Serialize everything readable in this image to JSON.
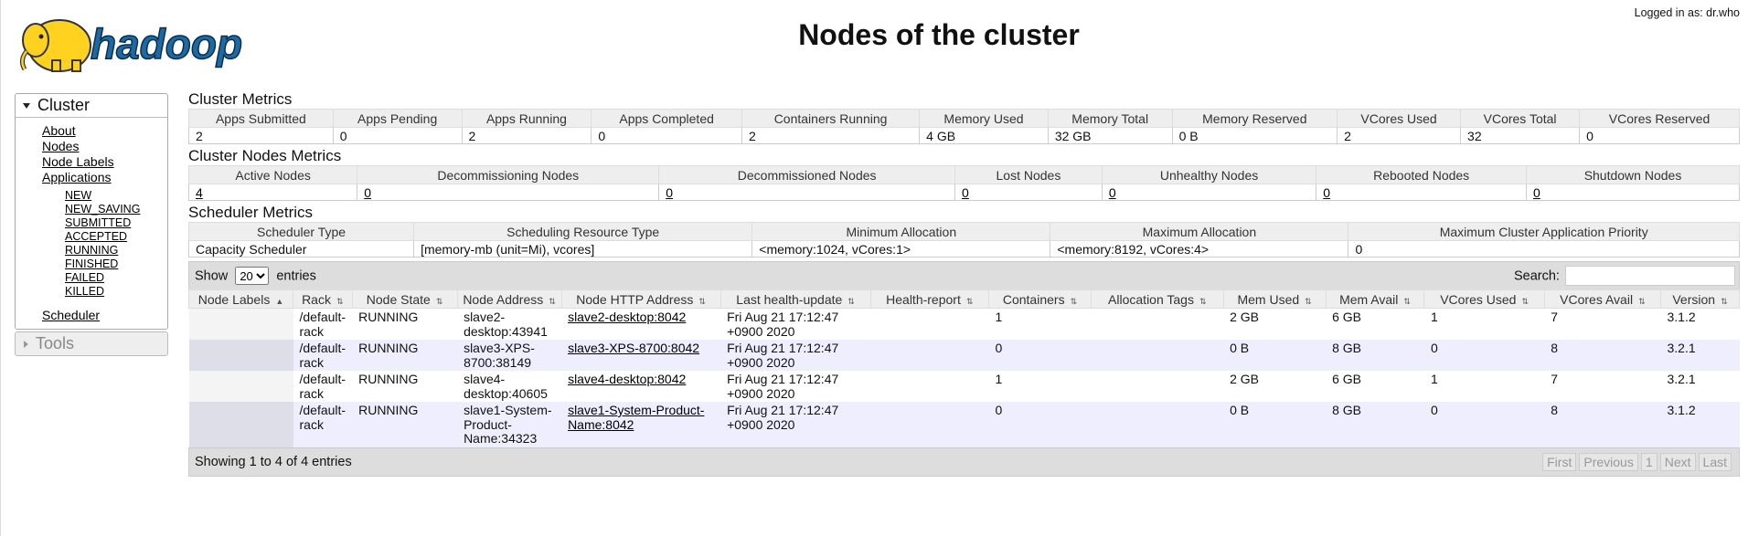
{
  "header": {
    "logo_text": "hadoop",
    "title": "Nodes of the cluster",
    "logged_in": "Logged in as: dr.who"
  },
  "nav": {
    "cluster_label": "Cluster",
    "links": [
      "About",
      "Nodes",
      "Node Labels",
      "Applications"
    ],
    "app_states": [
      "NEW",
      "NEW_SAVING",
      "SUBMITTED",
      "ACCEPTED",
      "RUNNING",
      "FINISHED",
      "FAILED",
      "KILLED"
    ],
    "scheduler": "Scheduler",
    "tools_label": "Tools"
  },
  "cluster_metrics": {
    "title": "Cluster Metrics",
    "headers": [
      "Apps Submitted",
      "Apps Pending",
      "Apps Running",
      "Apps Completed",
      "Containers Running",
      "Memory Used",
      "Memory Total",
      "Memory Reserved",
      "VCores Used",
      "VCores Total",
      "VCores Reserved"
    ],
    "values": [
      "2",
      "0",
      "2",
      "0",
      "2",
      "4 GB",
      "32 GB",
      "0 B",
      "2",
      "32",
      "0"
    ]
  },
  "node_metrics": {
    "title": "Cluster Nodes Metrics",
    "headers": [
      "Active Nodes",
      "Decommissioning Nodes",
      "Decommissioned Nodes",
      "Lost Nodes",
      "Unhealthy Nodes",
      "Rebooted Nodes",
      "Shutdown Nodes"
    ],
    "values": [
      "4",
      "0",
      "0",
      "0",
      "0",
      "0",
      "0"
    ]
  },
  "scheduler_metrics": {
    "title": "Scheduler Metrics",
    "headers": [
      "Scheduler Type",
      "Scheduling Resource Type",
      "Minimum Allocation",
      "Maximum Allocation",
      "Maximum Cluster Application Priority"
    ],
    "values": [
      "Capacity Scheduler",
      "[memory-mb (unit=Mi), vcores]",
      "<memory:1024, vCores:1>",
      "<memory:8192, vCores:4>",
      "0"
    ]
  },
  "table_controls": {
    "show": "Show",
    "entries_value": "20",
    "entries": "entries",
    "search": "Search:"
  },
  "nodes": {
    "headers": [
      "Node Labels",
      "Rack",
      "Node State",
      "Node Address",
      "Node HTTP Address",
      "Last health-update",
      "Health-report",
      "Containers",
      "Allocation Tags",
      "Mem Used",
      "Mem Avail",
      "VCores Used",
      "VCores Avail",
      "Version"
    ],
    "rows": [
      {
        "labels": "",
        "rack": "/default-rack",
        "state": "RUNNING",
        "address": "slave2-desktop:43941",
        "http": "slave2-desktop:8042",
        "health": "Fri Aug 21 17:12:47 +0900 2020",
        "report": "",
        "containers": "1",
        "tags": "",
        "mem_used": "2 GB",
        "mem_avail": "6 GB",
        "vc_used": "1",
        "vc_avail": "7",
        "version": "3.1.2"
      },
      {
        "labels": "",
        "rack": "/default-rack",
        "state": "RUNNING",
        "address": "slave3-XPS-8700:38149",
        "http": "slave3-XPS-8700:8042",
        "health": "Fri Aug 21 17:12:47 +0900 2020",
        "report": "",
        "containers": "0",
        "tags": "",
        "mem_used": "0 B",
        "mem_avail": "8 GB",
        "vc_used": "0",
        "vc_avail": "8",
        "version": "3.2.1"
      },
      {
        "labels": "",
        "rack": "/default-rack",
        "state": "RUNNING",
        "address": "slave4-desktop:40605",
        "http": "slave4-desktop:8042",
        "health": "Fri Aug 21 17:12:47 +0900 2020",
        "report": "",
        "containers": "1",
        "tags": "",
        "mem_used": "2 GB",
        "mem_avail": "6 GB",
        "vc_used": "1",
        "vc_avail": "7",
        "version": "3.2.1"
      },
      {
        "labels": "",
        "rack": "/default-rack",
        "state": "RUNNING",
        "address": "slave1-System-Product-Name:34323",
        "http": "slave1-System-Product-Name:8042",
        "health": "Fri Aug 21 17:12:47 +0900 2020",
        "report": "",
        "containers": "0",
        "tags": "",
        "mem_used": "0 B",
        "mem_avail": "8 GB",
        "vc_used": "0",
        "vc_avail": "8",
        "version": "3.1.2"
      }
    ]
  },
  "footer": {
    "info": "Showing 1 to 4 of 4 entries",
    "pager": [
      "First",
      "Previous",
      "1",
      "Next",
      "Last"
    ]
  }
}
